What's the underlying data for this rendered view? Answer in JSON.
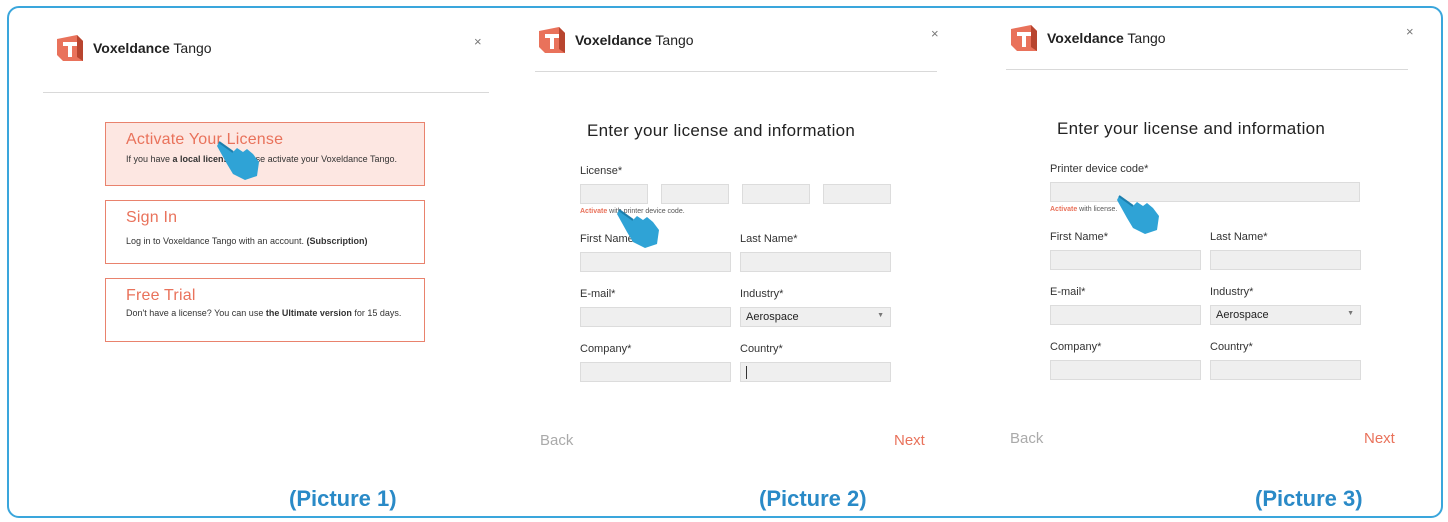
{
  "brand": {
    "name_bold": "Voxeldance",
    "name_rest": "Tango"
  },
  "close_glyph": "×",
  "picture1": {
    "options": [
      {
        "title": "Activate Your License",
        "desc_pre": "If you have ",
        "desc_bold": "a local license",
        "desc_post": ", please activate your Voxeldance Tango."
      },
      {
        "title": "Sign In",
        "desc_pre": "Log in to Voxeldance Tango with an account. ",
        "desc_bold": "(Subscription)",
        "desc_post": ""
      },
      {
        "title": "Free Trial",
        "desc_pre": "Don't have a license? You can use ",
        "desc_bold": "the Ultimate version",
        "desc_post": " for 15 days."
      }
    ],
    "caption": "(Picture 1)"
  },
  "picture2": {
    "heading": "Enter your license and information",
    "license_label": "License*",
    "hint_link": "Activate",
    "hint_text": " with printer device code.",
    "first_name_label": "First Name*",
    "last_name_label": "Last Name*",
    "email_label": "E-mail*",
    "industry_label": "Industry*",
    "industry_value": "Aerospace",
    "company_label": "Company*",
    "country_label": "Country*",
    "back_label": "Back",
    "next_label": "Next",
    "caption": "(Picture 2)"
  },
  "picture3": {
    "heading": "Enter your license and information",
    "device_code_label": "Printer device code*",
    "hint_link": "Activate",
    "hint_text": " with license.",
    "first_name_label": "First Name*",
    "last_name_label": "Last Name*",
    "email_label": "E-mail*",
    "industry_label": "Industry*",
    "industry_value": "Aerospace",
    "company_label": "Company*",
    "country_label": "Country*",
    "back_label": "Back",
    "next_label": "Next",
    "caption": "(Picture 3)"
  },
  "colors": {
    "accent": "#e9725b",
    "caption_blue": "#2a8ac7",
    "frame_blue": "#3aa6dc",
    "hand_blue": "#2fa3d6"
  },
  "icons": {
    "logo": "voxeldance-logo-icon",
    "close": "close-icon",
    "pointer": "pointing-hand-icon",
    "dropdown": "chevron-down-icon"
  }
}
